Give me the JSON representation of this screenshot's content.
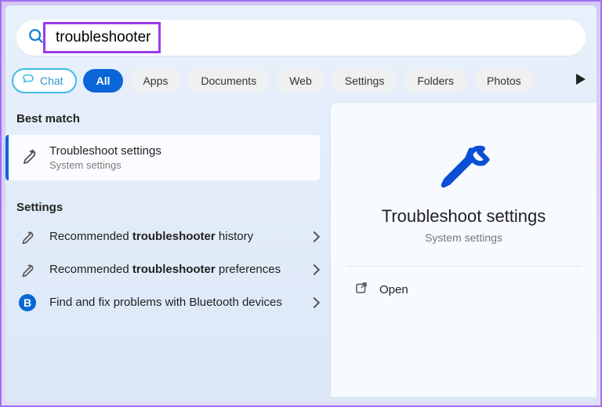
{
  "search": {
    "value": "troubleshooter"
  },
  "tabs": {
    "chat": "Chat",
    "items": [
      "All",
      "Apps",
      "Documents",
      "Web",
      "Settings",
      "Folders",
      "Photos"
    ]
  },
  "sections": {
    "best_match_label": "Best match",
    "settings_label": "Settings"
  },
  "best_match": {
    "title": "Troubleshoot settings",
    "subtitle": "System settings"
  },
  "settings_items": [
    {
      "prefix": "Recommended ",
      "bold": "troubleshooter",
      "suffix": " history"
    },
    {
      "prefix": "Recommended ",
      "bold": "troubleshooter",
      "suffix": " preferences"
    },
    {
      "plain": "Find and fix problems with Bluetooth devices"
    }
  ],
  "preview": {
    "title": "Troubleshoot settings",
    "subtitle": "System settings",
    "open": "Open"
  }
}
